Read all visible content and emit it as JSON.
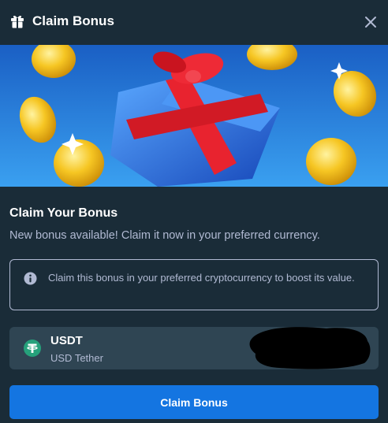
{
  "header": {
    "title": "Claim Bonus",
    "gift_icon": "gift-icon",
    "close_icon": "close-icon"
  },
  "banner": {
    "image": "gift-box-with-gold-coins"
  },
  "content": {
    "heading": "Claim Your Bonus",
    "subtext": "New bonus available! Claim it now in your preferred currency.",
    "info": {
      "icon": "info-icon",
      "text": "Claim this bonus in your preferred cryptocurrency to boost its value."
    },
    "currency": {
      "icon": "tether-icon",
      "code": "USDT",
      "name": "USD Tether"
    },
    "button_label": "Claim Bonus"
  },
  "colors": {
    "background": "#1a2c38",
    "panel": "#2f4553",
    "muted_text": "#b1bad3",
    "accent": "#1475e1",
    "tether": "#26a17b",
    "banner_sky": "#1e73d8"
  }
}
